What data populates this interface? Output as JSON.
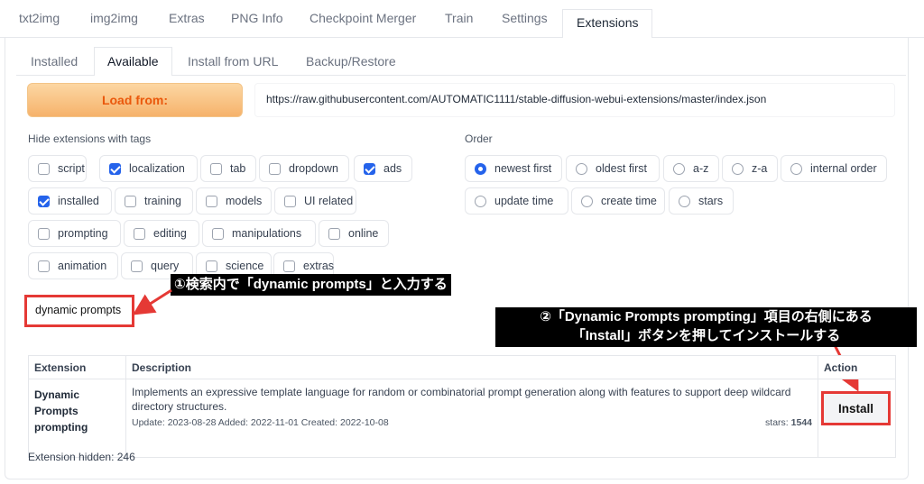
{
  "top_tabs": [
    "txt2img",
    "img2img",
    "Extras",
    "PNG Info",
    "Checkpoint Merger",
    "Train",
    "Settings",
    "Extensions"
  ],
  "sub_tabs": [
    "Installed",
    "Available",
    "Install from URL",
    "Backup/Restore"
  ],
  "load_button": "Load from:",
  "url": "https://raw.githubusercontent.com/AUTOMATIC1111/stable-diffusion-webui-extensions/master/index.json",
  "hide_label": "Hide extensions with tags",
  "tags": [
    {
      "label": "script",
      "checked": false
    },
    {
      "label": "localization",
      "checked": true
    },
    {
      "label": "tab",
      "checked": false
    },
    {
      "label": "dropdown",
      "checked": false
    },
    {
      "label": "ads",
      "checked": true
    },
    {
      "label": "installed",
      "checked": true
    },
    {
      "label": "training",
      "checked": false
    },
    {
      "label": "models",
      "checked": false
    },
    {
      "label": "UI related",
      "checked": false
    },
    {
      "label": "prompting",
      "checked": false
    },
    {
      "label": "editing",
      "checked": false
    },
    {
      "label": "manipulations",
      "checked": false
    },
    {
      "label": "online",
      "checked": false
    },
    {
      "label": "animation",
      "checked": false
    },
    {
      "label": "query",
      "checked": false
    },
    {
      "label": "science",
      "checked": false
    },
    {
      "label": "extras",
      "checked": false
    }
  ],
  "order_label": "Order",
  "order_options": [
    {
      "label": "newest first",
      "selected": true
    },
    {
      "label": "oldest first",
      "selected": false
    },
    {
      "label": "a-z",
      "selected": false
    },
    {
      "label": "z-a",
      "selected": false
    },
    {
      "label": "internal order",
      "selected": false
    },
    {
      "label": "update time",
      "selected": false
    },
    {
      "label": "create time",
      "selected": false
    },
    {
      "label": "stars",
      "selected": false
    }
  ],
  "search_value": "dynamic prompts",
  "annotation1": "①検索内で「dynamic prompts」と入力する",
  "annotation2_line1": "②「Dynamic Prompts prompting」項目の右側にある",
  "annotation2_line2": "「Install」ボタンを押してインストールする",
  "table": {
    "headers": [
      "Extension",
      "Description",
      "Action"
    ],
    "row": {
      "name": "Dynamic Prompts prompting",
      "description": "Implements an expressive template language for random or combinatorial prompt generation along with features to support deep wildcard directory structures.",
      "dates": "Update: 2023-08-28 Added: 2022-11-01 Created: 2022-10-08",
      "stars_label": "stars:",
      "stars": "1544",
      "action": "Install"
    }
  },
  "hidden_count": "Extension hidden: 246",
  "colors": {
    "accent": "#2563eb",
    "annotation_red": "#e53935",
    "load_orange": "#ea580c"
  }
}
